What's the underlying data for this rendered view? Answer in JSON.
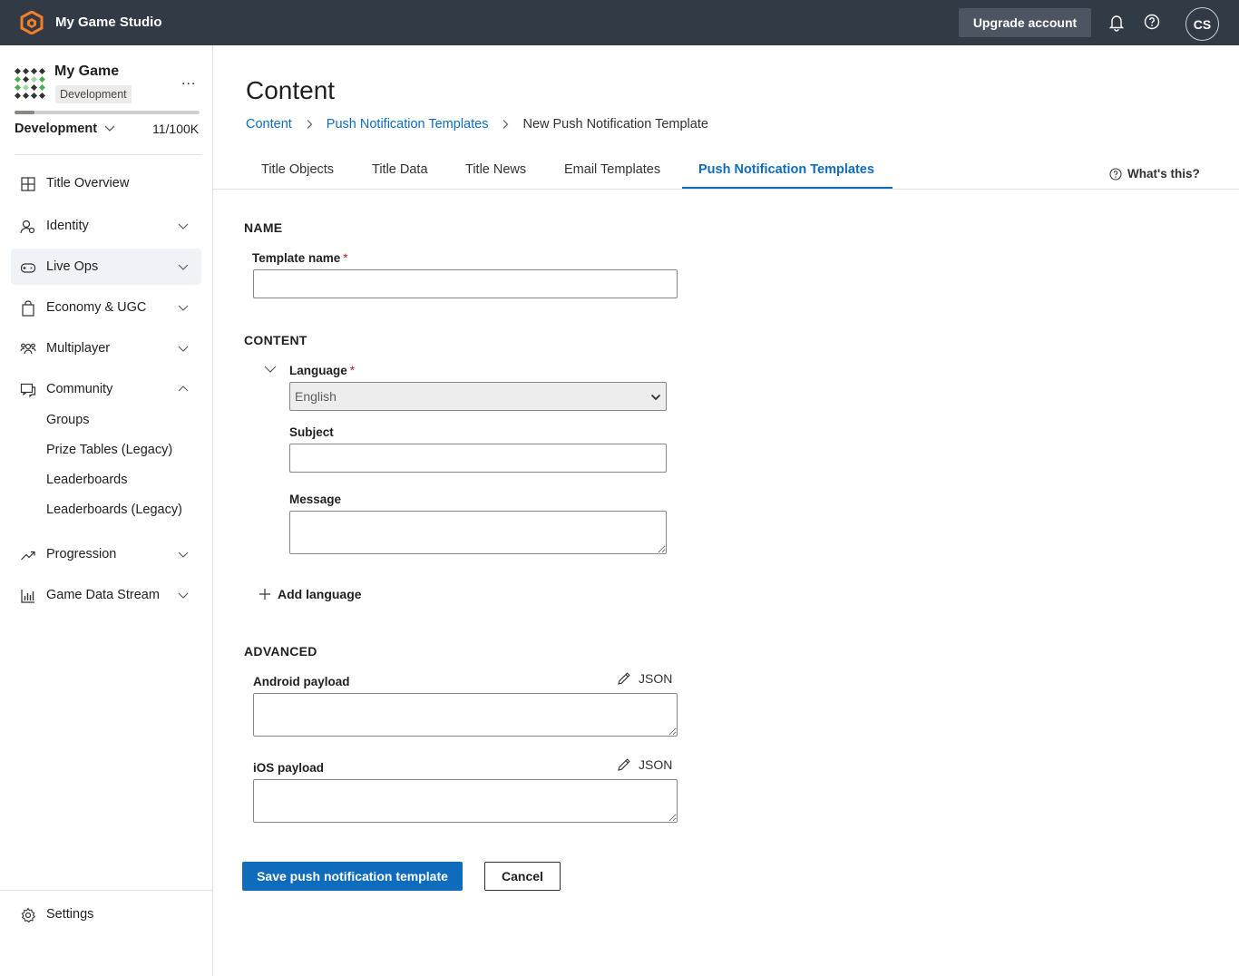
{
  "topbar": {
    "studio_name": "My Game Studio",
    "upgrade_label": "Upgrade account",
    "avatar_initials": "CS",
    "logo_icon": "playfab-hexagon-icon",
    "bell_icon": "bell-icon",
    "help_icon": "help-circle-icon",
    "background": "#323a45"
  },
  "sidebar": {
    "game_name": "My Game",
    "game_badge": "Development",
    "more_label": "...",
    "environment": "Development",
    "usage": "11/100K",
    "usage_fraction": 0.11,
    "items": [
      {
        "label": "Title Overview",
        "icon": "grid-icon"
      },
      {
        "label": "Identity",
        "icon": "identity-icon"
      },
      {
        "label": "Live Ops",
        "icon": "gamepad-icon"
      },
      {
        "label": "Economy & UGC",
        "icon": "shopping-bag-icon"
      },
      {
        "label": "Multiplayer",
        "icon": "people-icon"
      },
      {
        "label": "Community",
        "icon": "chat-icon"
      },
      {
        "label": "Progression",
        "icon": "trending-up-icon"
      },
      {
        "label": "Game Data Stream",
        "icon": "bar-chart-icon"
      }
    ],
    "community_sub": [
      "Groups",
      "Prize Tables (Legacy)",
      "Leaderboards",
      "Leaderboards (Legacy)"
    ],
    "settings_label": "Settings"
  },
  "main": {
    "title": "Content",
    "breadcrumb": [
      "Content",
      "Push Notification Templates",
      "New Push Notification Template"
    ],
    "tabs": [
      "Title Objects",
      "Title Data",
      "Title News",
      "Email Templates",
      "Push Notification Templates"
    ],
    "whats_this": "What's this?",
    "accent": "#0f6cbd"
  },
  "form": {
    "name_section": "NAME",
    "template_name_label": "Template name",
    "required_mark": "*",
    "template_name_value": "",
    "content_section": "CONTENT",
    "language_label": "Language",
    "language_value": "English",
    "subject_label": "Subject",
    "subject_value": "",
    "message_label": "Message",
    "message_value": "",
    "add_language": "Add language",
    "advanced_section": "ADVANCED",
    "android_label": "Android payload",
    "ios_label": "iOS payload",
    "json_label": "JSON",
    "save_label": "Save push notification template",
    "cancel_label": "Cancel"
  }
}
